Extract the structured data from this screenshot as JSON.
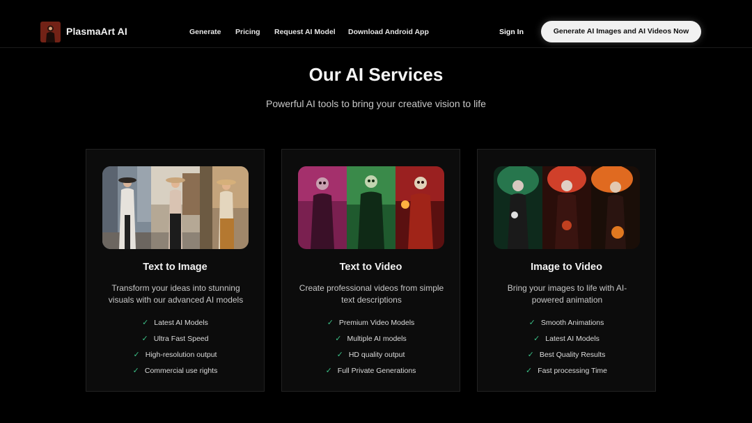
{
  "nav": {
    "brand": "PlasmaArt AI",
    "links": [
      "Generate",
      "Pricing",
      "Request AI Model",
      "Download Android App"
    ],
    "sign_in": "Sign In",
    "cta": "Generate AI Images and AI Videos Now"
  },
  "section": {
    "title": "Our AI Services",
    "subtitle": "Powerful AI tools to bring your creative vision to life"
  },
  "cards": [
    {
      "title": "Text to Image",
      "description": "Transform your ideas into stunning visuals with our advanced AI models",
      "features": [
        "Latest AI Models",
        "Ultra Fast Speed",
        "High-resolution output",
        "Commercial use rights"
      ]
    },
    {
      "title": "Text to Video",
      "description": "Create professional videos from simple text descriptions",
      "features": [
        "Premium Video Models",
        "Multiple AI models",
        "HD quality output",
        "Full Private Generations"
      ]
    },
    {
      "title": "Image to Video",
      "description": "Bring your images to life with AI-powered animation",
      "features": [
        "Smooth Animations",
        "Latest AI Models",
        "Best Quality Results",
        "Fast processing Time"
      ]
    }
  ],
  "colors": {
    "background": "#000000",
    "card_bg": "#0c0c0c",
    "check": "#3bbf86",
    "cta_bg": "#f1f1f1"
  }
}
